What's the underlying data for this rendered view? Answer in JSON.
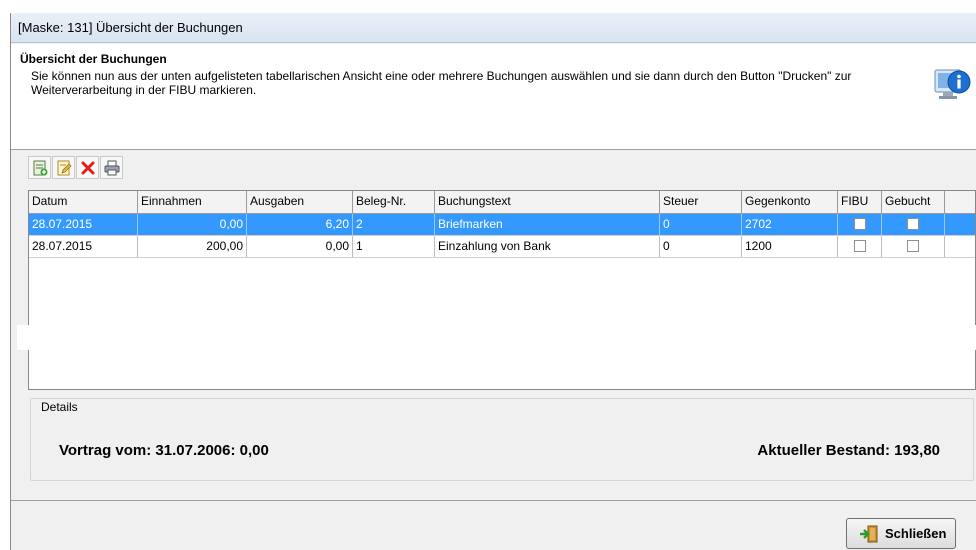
{
  "window": {
    "title": "[Maske: 131]  Übersicht der Buchungen"
  },
  "header": {
    "title": "Übersicht der Buchungen",
    "description": "Sie können nun aus der unten aufgelisteten tabellarischen Ansicht eine oder mehrere Buchungen auswählen und sie dann durch den Button \"Drucken\" zur Weiterverarbeitung in der FIBU markieren."
  },
  "toolbar": {
    "buttons": [
      {
        "icon": "new-record-icon"
      },
      {
        "icon": "edit-record-icon"
      },
      {
        "icon": "delete-icon"
      },
      {
        "icon": "print-icon"
      }
    ]
  },
  "table": {
    "columns": [
      "Datum",
      "Einnahmen",
      "Ausgaben",
      "Beleg-Nr.",
      "Buchungstext",
      "Steuer",
      "Gegenkonto",
      "FIBU",
      "Gebucht"
    ],
    "rows": [
      {
        "datum": "28.07.2015",
        "einnahmen": "0,00",
        "ausgaben": "6,20",
        "beleg": "2",
        "text": "Briefmarken",
        "steuer": "0",
        "gegenkonto": "2702",
        "fibu": false,
        "gebucht": false,
        "selected": true
      },
      {
        "datum": "28.07.2015",
        "einnahmen": "200,00",
        "ausgaben": "0,00",
        "beleg": "1",
        "text": "Einzahlung von Bank",
        "steuer": "0",
        "gegenkonto": "1200",
        "fibu": false,
        "gebucht": false,
        "selected": false
      }
    ]
  },
  "details": {
    "legend": "Details",
    "vortrag": "Vortrag vom: 31.07.2006: 0,00",
    "bestand": "Aktueller Bestand: 193,80"
  },
  "footer": {
    "close_label": "Schließen"
  },
  "colors": {
    "selection": "#3399ff",
    "titlebar": "#dde7f3",
    "delete": "#e0201b"
  }
}
